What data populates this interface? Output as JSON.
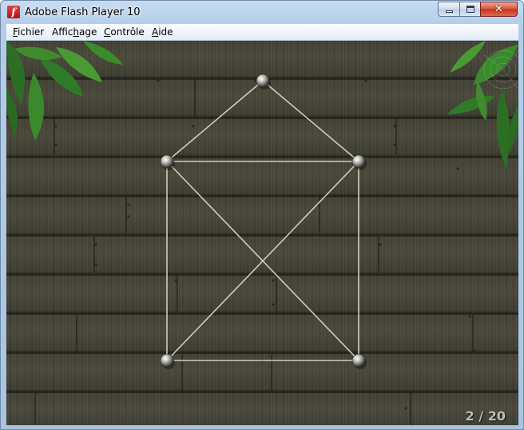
{
  "window": {
    "title": "Adobe Flash Player 10",
    "close_glyph": "✕"
  },
  "menu": {
    "items": [
      {
        "pre": "",
        "key": "F",
        "post": "ichier"
      },
      {
        "pre": "Affic",
        "key": "h",
        "post": "age"
      },
      {
        "pre": "",
        "key": "C",
        "post": "ontrôle"
      },
      {
        "pre": "",
        "key": "A",
        "post": "ide"
      }
    ]
  },
  "game": {
    "level_counter": "2 / 20",
    "pins": [
      "top",
      "upper-left",
      "upper-right",
      "lower-left",
      "lower-right"
    ],
    "strings": [
      [
        "top",
        "upper-left"
      ],
      [
        "top",
        "upper-right"
      ],
      [
        "upper-left",
        "upper-right"
      ],
      [
        "upper-left",
        "lower-left"
      ],
      [
        "upper-right",
        "lower-right"
      ],
      [
        "lower-left",
        "lower-right"
      ],
      [
        "upper-left",
        "lower-right"
      ],
      [
        "upper-right",
        "lower-left"
      ]
    ]
  },
  "colors": {
    "wood": "#43423a",
    "string": "#dcdcd2",
    "leaf": "#2f7a2a",
    "titlebar": "#b9d1ea"
  }
}
